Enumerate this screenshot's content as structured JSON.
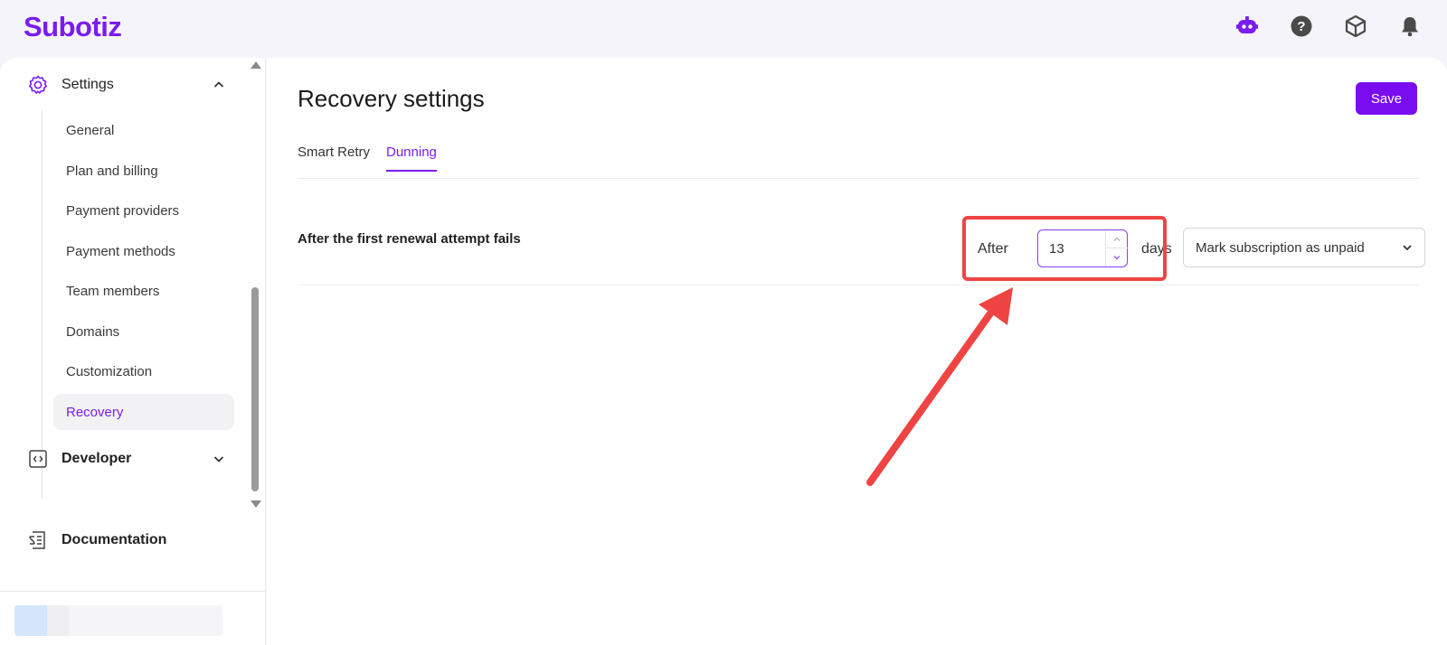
{
  "app": {
    "logo_text": "Subotiz"
  },
  "topbar": {
    "icons": [
      "bot-icon",
      "help-icon",
      "cube-icon",
      "bell-icon"
    ],
    "accent_color": "#7a1cf0"
  },
  "sidebar": {
    "settings": {
      "label": "Settings"
    },
    "items": [
      {
        "label": "General"
      },
      {
        "label": "Plan and billing"
      },
      {
        "label": "Payment providers"
      },
      {
        "label": "Payment methods"
      },
      {
        "label": "Team members"
      },
      {
        "label": "Domains"
      },
      {
        "label": "Customization"
      },
      {
        "label": "Recovery",
        "active": true
      }
    ],
    "developer": {
      "label": "Developer"
    },
    "documentation": {
      "label": "Documentation"
    }
  },
  "main": {
    "title": "Recovery settings",
    "save_label": "Save",
    "tabs": [
      {
        "label": "Smart Retry"
      },
      {
        "label": "Dunning",
        "active": true
      }
    ],
    "rule": {
      "label": "After the first renewal attempt fails",
      "after_text": "After",
      "days_value": "13",
      "days_text": "days",
      "action_value": "Mark subscription as unpaid"
    }
  },
  "annotation": {
    "color": "#ee4444"
  }
}
